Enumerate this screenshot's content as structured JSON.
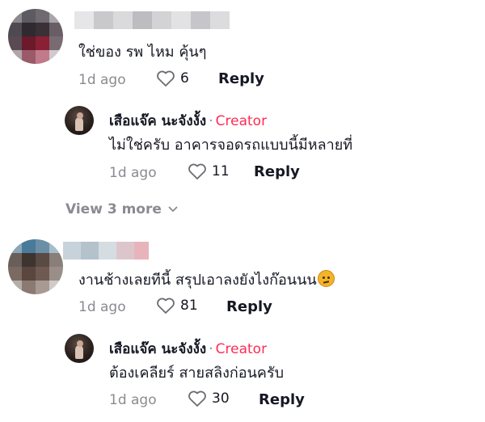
{
  "comments": [
    {
      "text": "ใช่ของ รพ ไหม คุ้นๆ",
      "time": "1d ago",
      "likes": "6",
      "reply_label": "Reply",
      "reply": {
        "author": "เสือแจ๊ค นะจังงั้ง",
        "separator": "·",
        "badge": "Creator",
        "text": "ไม่ใช่ครับ อาคารจอดรถแบบนี้มีหลายที่",
        "time": "1d ago",
        "likes": "11",
        "reply_label": "Reply"
      },
      "view_more": "View 3 more"
    },
    {
      "text": "งานช้างเลยทีนี้ สรุปเอาลงยังไงก๊อนนน",
      "emoji_icon": "thinking-face-emoji",
      "time": "1d ago",
      "likes": "81",
      "reply_label": "Reply",
      "reply": {
        "author": "เสือแจ๊ค นะจังงั้ง",
        "separator": "·",
        "badge": "Creator",
        "text": "ต้องเคลียร์ สายสลิงก่อนครับ",
        "time": "1d ago",
        "likes": "30",
        "reply_label": "Reply"
      }
    }
  ],
  "colors": {
    "creator": "#fe2c55",
    "muted": "#8a8b91",
    "text": "#161823"
  }
}
